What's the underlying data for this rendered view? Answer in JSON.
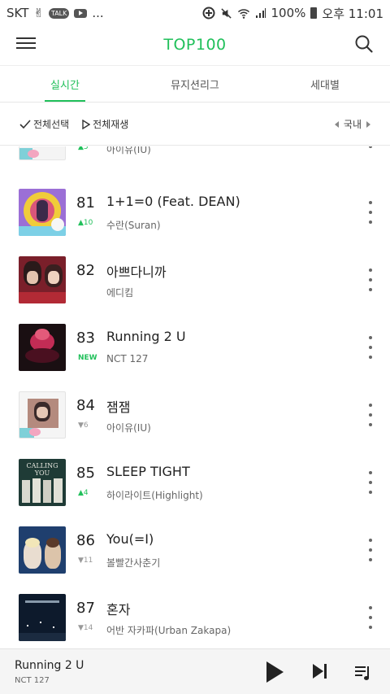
{
  "status_bar": {
    "carrier": "SKT",
    "talk_badge": "TALK",
    "more": "...",
    "battery": "100%",
    "time": "오후 11:01"
  },
  "header": {
    "title": "TOP100"
  },
  "tabs": [
    {
      "label": "실시간"
    },
    {
      "label": "뮤지션리그"
    },
    {
      "label": "세대별"
    }
  ],
  "toolbar": {
    "select_all": "전체선택",
    "play_all": "전체재생",
    "region": "국내"
  },
  "songs": [
    {
      "rank": "",
      "delta": "▲5",
      "delta_type": "up",
      "title": "",
      "artist": "아이유(IU)"
    },
    {
      "rank": "81",
      "delta": "▲10",
      "delta_type": "up",
      "title": "1+1=0 (Feat. DEAN)",
      "artist": "수란(Suran)"
    },
    {
      "rank": "82",
      "delta": "",
      "delta_type": "none",
      "title": "아쁘다니까",
      "artist": "에디킴"
    },
    {
      "rank": "83",
      "delta": "NEW",
      "delta_type": "new",
      "title": "Running 2 U",
      "artist": "NCT 127"
    },
    {
      "rank": "84",
      "delta": "▼6",
      "delta_type": "down",
      "title": "잼잼",
      "artist": "아이유(IU)"
    },
    {
      "rank": "85",
      "delta": "▲4",
      "delta_type": "up",
      "title": "SLEEP TIGHT",
      "artist": "하이라이트(Highlight)"
    },
    {
      "rank": "86",
      "delta": "▼11",
      "delta_type": "down",
      "title": "You(=I)",
      "artist": "볼빨간사춘기"
    },
    {
      "rank": "87",
      "delta": "▼14",
      "delta_type": "down",
      "title": "혼자",
      "artist": "어반 자카파(Urban Zakapa)"
    }
  ],
  "album_art": {
    "calling_you_text": "CALLING YOU"
  },
  "player": {
    "title": "Running 2 U",
    "artist": "NCT 127"
  },
  "colors": {
    "accent": "#21c05b",
    "text": "#222222",
    "muted": "#999999"
  }
}
